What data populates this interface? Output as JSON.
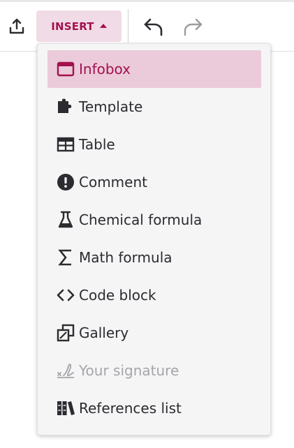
{
  "toolbar": {
    "insert_label": "INSERT",
    "upload_icon": "upload-icon",
    "undo_icon": "undo-icon",
    "redo_icon": "redo-icon"
  },
  "colors": {
    "accent": "#a3114f",
    "active_bg": "#ebcad9",
    "insert_bg": "#f1dbe6",
    "disabled_text": "#a5a5aa"
  },
  "insert_menu": {
    "items": [
      {
        "label": "Infobox",
        "icon": "infobox-icon",
        "state": "active"
      },
      {
        "label": "Template",
        "icon": "puzzle-icon",
        "state": "normal"
      },
      {
        "label": "Table",
        "icon": "table-icon",
        "state": "normal"
      },
      {
        "label": "Comment",
        "icon": "comment-icon",
        "state": "normal"
      },
      {
        "label": "Chemical formula",
        "icon": "flask-icon",
        "state": "normal"
      },
      {
        "label": "Math formula",
        "icon": "sigma-icon",
        "state": "normal"
      },
      {
        "label": "Code block",
        "icon": "code-icon",
        "state": "normal"
      },
      {
        "label": "Gallery",
        "icon": "gallery-icon",
        "state": "normal"
      },
      {
        "label": "Your signature",
        "icon": "signature-icon",
        "state": "disabled"
      },
      {
        "label": "References list",
        "icon": "references-icon",
        "state": "normal"
      }
    ]
  }
}
